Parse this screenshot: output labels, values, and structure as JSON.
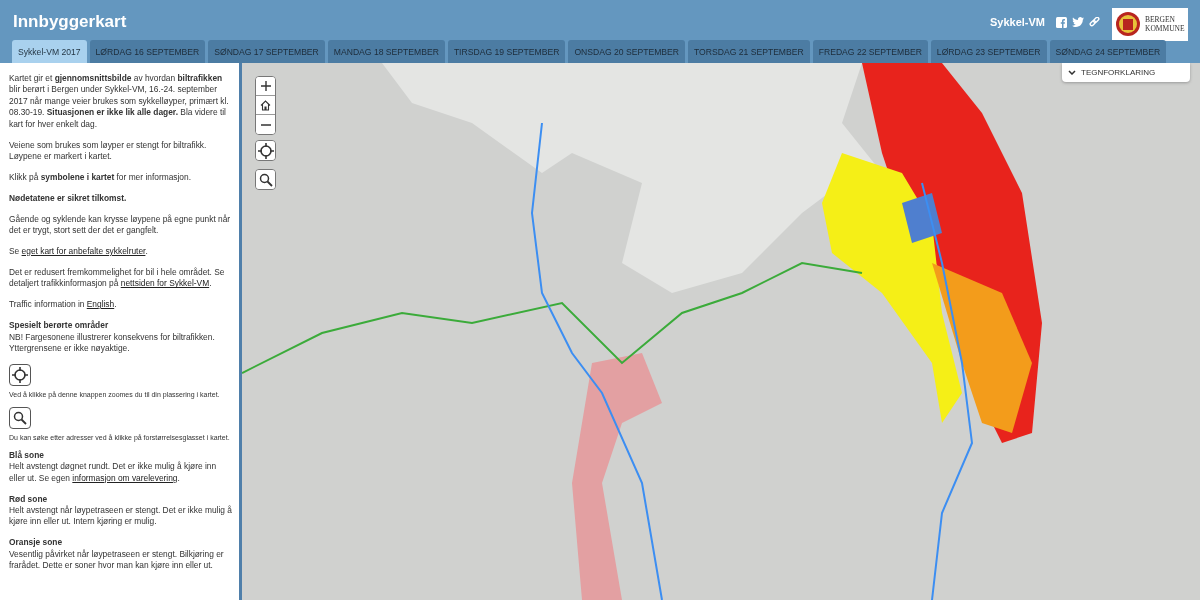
{
  "header": {
    "title": "Innbyggerkart",
    "site_link": "Sykkel-VM",
    "logo_text": [
      "BERGEN",
      "KOMMUNE"
    ]
  },
  "tabs": [
    {
      "label": "Sykkel-VM 2017",
      "selected": true
    },
    {
      "label": "LØRDAG 16 SEPTEMBER",
      "selected": false
    },
    {
      "label": "SØNDAG 17 SEPTEMBER",
      "selected": false
    },
    {
      "label": "MANDAG 18 SEPTEMBER",
      "selected": false
    },
    {
      "label": "TIRSDAG 19 SEPTEMBER",
      "selected": false
    },
    {
      "label": "ONSDAG 20 SEPTEMBER",
      "selected": false
    },
    {
      "label": "TORSDAG 21 SEPTEMBER",
      "selected": false
    },
    {
      "label": "FREDAG 22 SEPTEMBER",
      "selected": false
    },
    {
      "label": "LØRDAG 23 SEPTEMBER",
      "selected": false
    },
    {
      "label": "SØNDAG 24 SEPTEMBER",
      "selected": false
    }
  ],
  "sidebar": {
    "paragraphs": [
      [
        {
          "kind": "text",
          "text": "Kartet gir et **gjennomsnittsbilde** av hvordan **biltrafikken** blir berørt i Bergen under Sykkel-VM, 16.-24. september 2017 når mange veier brukes som sykkelløyper, primært kl. 08.30-19. **Situasjonen er ikke lik alle dager.** Bla videre til kart for hver enkelt dag."
        }
      ],
      [
        {
          "kind": "text",
          "text": "Veiene som brukes som løyper er stengt for biltrafikk. Løypene er markert i kartet."
        }
      ],
      [
        {
          "kind": "text",
          "text": "Klikk på **symbolene i kartet** for mer informasjon."
        }
      ],
      [
        {
          "kind": "text",
          "text": "**Nødetatene er sikret tilkomst.**"
        }
      ],
      [
        {
          "kind": "text",
          "text": "Gående og syklende kan krysse løypene på egne punkt når det er trygt, stort sett der det er gangfelt."
        }
      ],
      [
        {
          "kind": "text",
          "text": "Se "
        },
        {
          "kind": "link",
          "text": "eget kart for anbefalte sykkelruter"
        },
        {
          "kind": "text",
          "text": "."
        }
      ],
      [
        {
          "kind": "text",
          "text": "Det er redusert fremkommelighet for bil i hele området. Se detaljert trafikkinformasjon på "
        },
        {
          "kind": "link",
          "text": "nettsiden for Sykkel-VM"
        },
        {
          "kind": "text",
          "text": "."
        }
      ],
      [
        {
          "kind": "text",
          "text": "Traffic information in "
        },
        {
          "kind": "link",
          "text": "English"
        },
        {
          "kind": "text",
          "text": "."
        }
      ]
    ],
    "areas_heading": "Spesielt berørte områder",
    "areas_note": "NB! Fargesonene illustrerer konsekvens for biltrafikken. Yttergrensene er ikke nøyaktige.",
    "help": [
      {
        "kind": "locate",
        "text": "Ved å klikke på denne knappen zoomes du til din plassering i kartet."
      },
      {
        "kind": "search",
        "text": "Du kan søke etter adresser ved å klikke på forstørrelsesglasset i kartet."
      }
    ],
    "zones": [
      {
        "title": "Blå sone",
        "description": [
          {
            "kind": "text",
            "text": "Helt avstengt døgnet rundt. Det er ikke mulig å kjøre inn eller ut. Se egen "
          },
          {
            "kind": "link",
            "text": "informasjon om varelevering"
          },
          {
            "kind": "text",
            "text": "."
          }
        ]
      },
      {
        "title": "Rød sone",
        "description": [
          {
            "kind": "text",
            "text": "Helt avstengt når løypetraseen er stengt. Det er ikke mulig å kjøre inn eller ut. Intern kjøring er mulig."
          }
        ]
      },
      {
        "title": "Oransje sone",
        "description": [
          {
            "kind": "text",
            "text": "Vesentlig påvirket når løypetraseen er stengt. Bilkjøring er frarådet. Dette er soner hvor man kan kjøre inn eller ut."
          }
        ]
      }
    ]
  },
  "map": {
    "legend_button": "TEGNFORKLARING"
  }
}
